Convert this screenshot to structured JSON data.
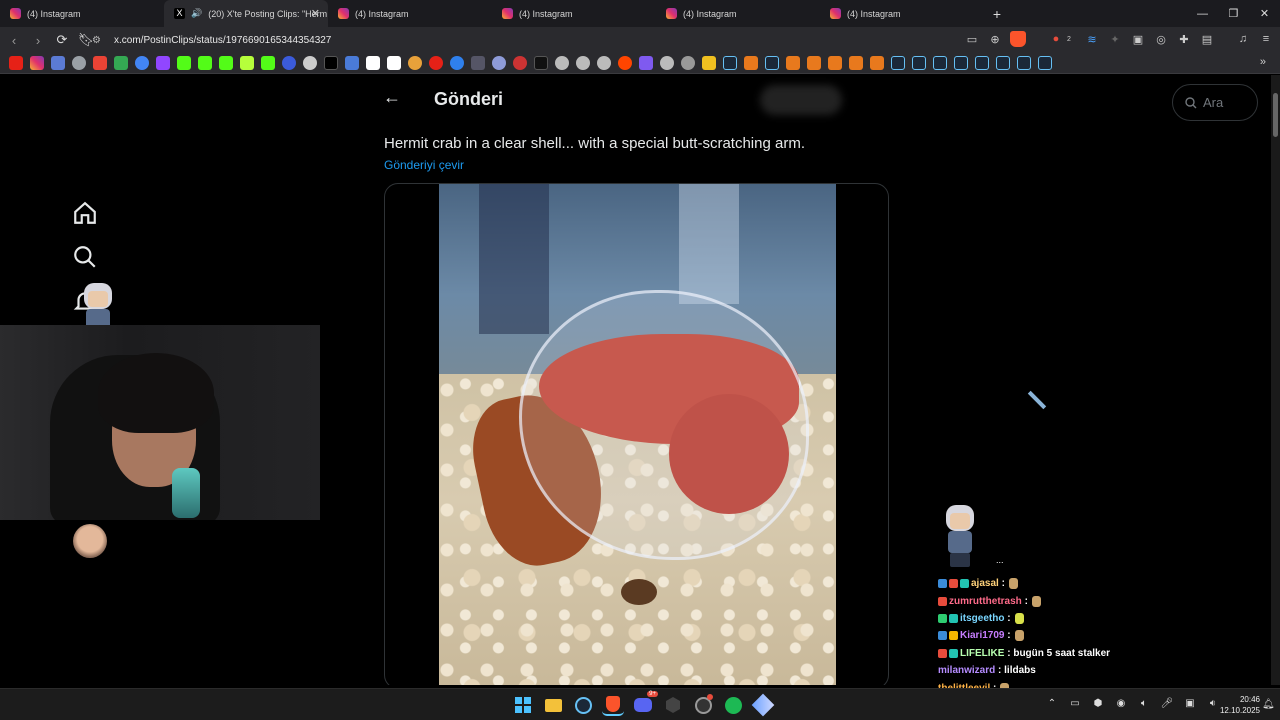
{
  "browser": {
    "tabs": [
      {
        "title": "(4) Instagram",
        "icon": "instagram-icon",
        "active": false
      },
      {
        "title": "(20) X'te  Posting Clips: \"Herm",
        "icon": "x-icon",
        "active": true
      },
      {
        "title": "(4) Instagram",
        "icon": "instagram-icon",
        "active": false
      },
      {
        "title": "(4) Instagram",
        "icon": "instagram-icon",
        "active": false
      },
      {
        "title": "(4) Instagram",
        "icon": "instagram-icon",
        "active": false
      },
      {
        "title": "(4) Instagram",
        "icon": "instagram-icon",
        "active": false
      }
    ],
    "new_tab": "+",
    "close_tab": "✕",
    "url": "x.com/PostinClips/status/1976690165344354327",
    "brave_badge": "2"
  },
  "page": {
    "title": "Gönderi",
    "search_placeholder": "Ara",
    "post_text": "Hermit crab in a clear shell... with a special butt-scratching arm.",
    "translate_link": "Gönderiyi çevir"
  },
  "chat": {
    "ellipsis": "...",
    "messages": [
      {
        "user": "ajasal",
        "color": "#ffd27a",
        "text": "",
        "badges": [
          "#3b8cd9",
          "#e74c3c",
          "#22c3b2"
        ]
      },
      {
        "user": "zumrutthetrash",
        "color": "#ff6b8a",
        "text": "",
        "badges": [
          "#e74c3c"
        ]
      },
      {
        "user": "itsgeetho",
        "color": "#7ad6ff",
        "text": "",
        "badges": [
          "#2ecc71",
          "#22c3b2"
        ]
      },
      {
        "user": "Kiari1709",
        "color": "#c77dff",
        "text": "",
        "badges": [
          "#3b8cd9",
          "#f5b700"
        ]
      },
      {
        "user": "LIFELIKE",
        "color": "#b8ffb0",
        "text": "bugün 5 saat stalker",
        "badges": [
          "#e74c3c",
          "#22c3b2"
        ]
      },
      {
        "user": "milanwizard",
        "color": "#b58cff",
        "text": "lildabs",
        "badges": []
      },
      {
        "user": "thelittleevil",
        "color": "#ffb347",
        "text": "",
        "badges": []
      }
    ]
  },
  "taskbar": {
    "time": "20:46",
    "date": "12.10.2025",
    "discord_badge": "9+"
  }
}
